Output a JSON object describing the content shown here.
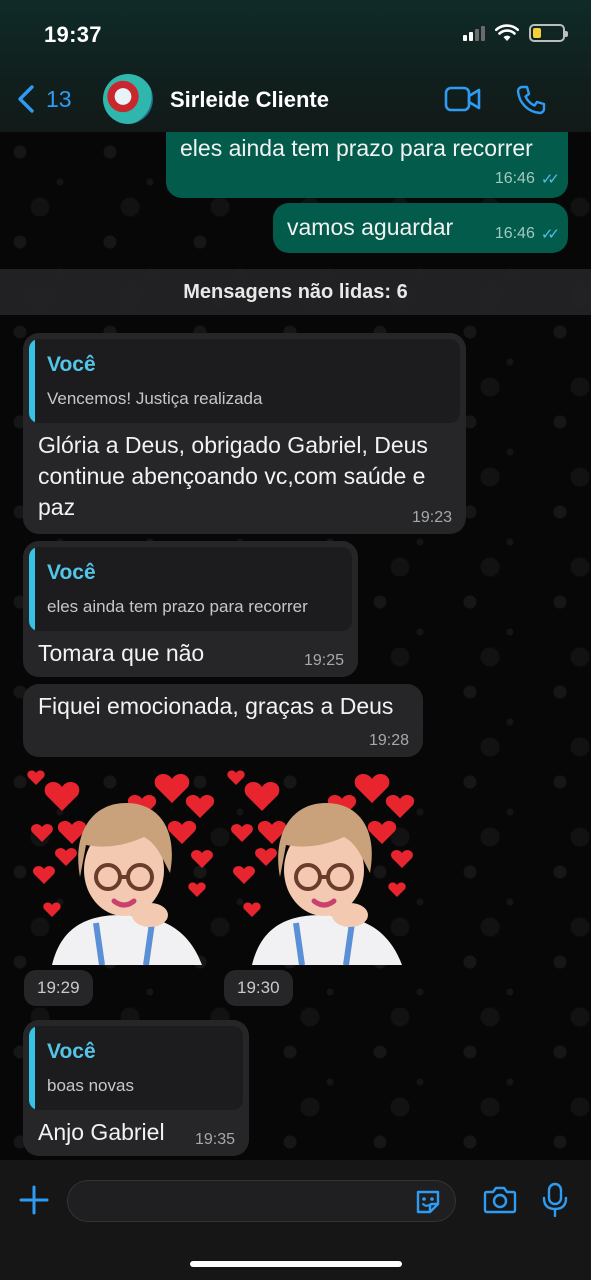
{
  "status_bar": {
    "time": "19:37"
  },
  "header": {
    "back_count": "13",
    "contact_name": "Sirleide Cliente"
  },
  "messages": {
    "m1": {
      "text": "eles ainda tem prazo para recorrer",
      "time": "16:46"
    },
    "m2": {
      "text": "vamos aguardar",
      "time": "16:46"
    },
    "unread_label": "Mensagens não lidas: 6",
    "m3": {
      "quote_author": "Você",
      "quote_text": "Vencemos! Justiça realizada",
      "lines": [
        "Glória a Deus, obrigado Gabriel, Deus",
        "continue abençoando vc,com saúde e",
        "paz"
      ],
      "time": "19:23"
    },
    "m4": {
      "quote_author": "Você",
      "quote_text": "eles ainda tem prazo para recorrer",
      "text": "Tomara que não",
      "time": "19:25"
    },
    "m5": {
      "text": "Fiquei emocionada, graças a Deus",
      "time": "19:28"
    },
    "sticker1": {
      "time": "19:29"
    },
    "sticker2": {
      "time": "19:30"
    },
    "m6": {
      "quote_author": "Você",
      "quote_text": "boas novas",
      "text": "Anjo Gabriel",
      "time": "19:35"
    }
  },
  "colors": {
    "accent_blue": "#2f9cf3",
    "outgoing_bubble": "#035c4b",
    "incoming_bubble": "#262628",
    "quote_author": "#53c6e8",
    "read_ticks": "#53bdeb"
  },
  "icons": [
    "back-chevron-icon",
    "video-call-icon",
    "phone-icon",
    "plus-icon",
    "sticker-icon",
    "camera-icon",
    "microphone-icon",
    "read-receipt-icon"
  ]
}
